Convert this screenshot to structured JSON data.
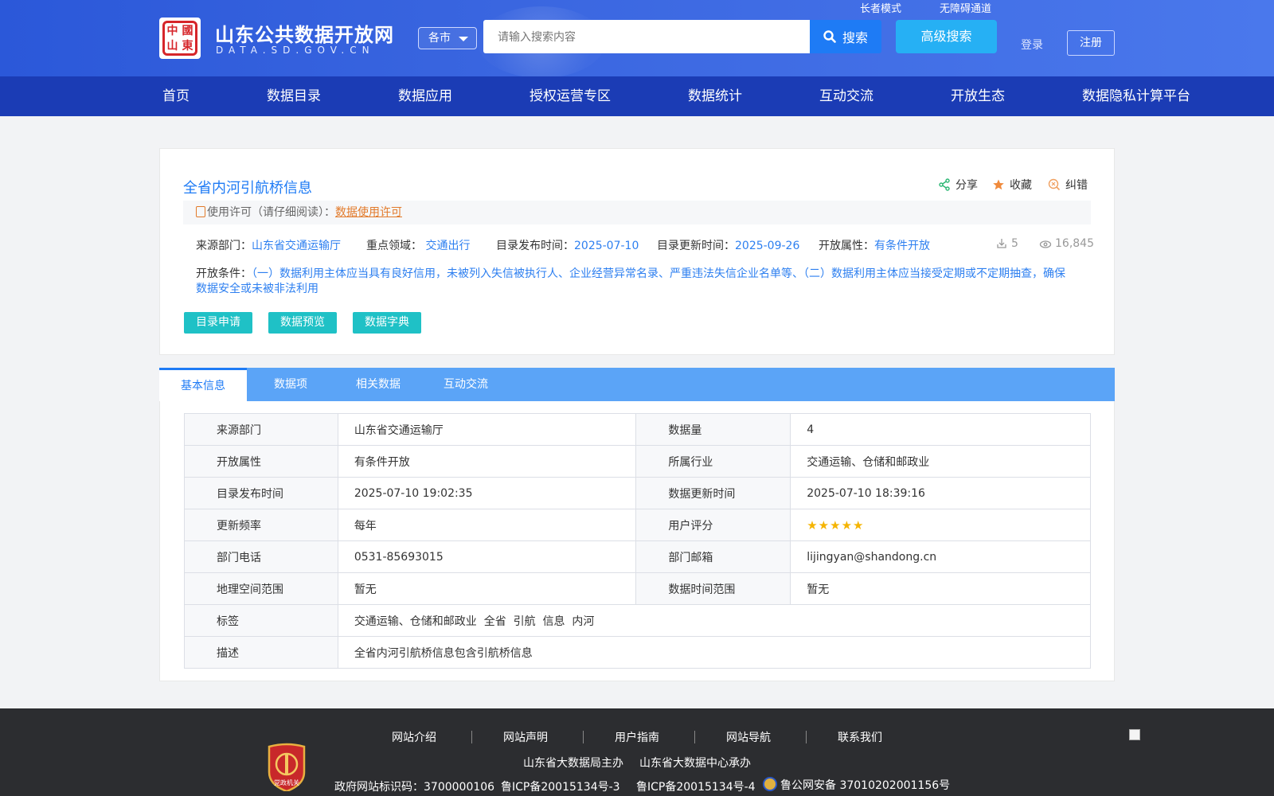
{
  "header": {
    "site_title": "山东公共数据开放网",
    "site_subtitle": "DATA.SD.GOV.CN",
    "logo_text": [
      "中",
      "國",
      "山",
      "東"
    ],
    "city_select": "各市",
    "search_placeholder": "请输入搜索内容",
    "search_button": "搜索",
    "advanced_search": "高级搜索",
    "elder_mode": "长者模式",
    "accessibility": "无障碍通道",
    "login": "登录",
    "register": "注册"
  },
  "nav": [
    "首页",
    "数据目录",
    "数据应用",
    "授权运营专区",
    "数据统计",
    "互动交流",
    "开放生态",
    "数据隐私计算平台"
  ],
  "dataset": {
    "title": "全省内河引航桥信息",
    "actions": {
      "share": "分享",
      "favorite": "收藏",
      "report": "纠错"
    },
    "license_label": "使用许可（请仔细阅读）：",
    "license_link": "数据使用许可",
    "source_label": "来源部门：",
    "source_value": "山东省交通运输厅",
    "domain_label": "重点领域：",
    "domain_value": "交通出行",
    "publish_label": "目录发布时间：",
    "publish_value": "2025-07-10",
    "update_label": "目录更新时间：",
    "update_value": "2025-09-26",
    "open_label": "开放属性：",
    "open_value": "有条件开放",
    "downloads": "5",
    "views": "16,845",
    "conditions_label": "开放条件：",
    "conditions_value": "（一）数据利用主体应当具有良好信用，未被列入失信被执行人、企业经营异常名录、严重违法失信企业名单等、（二）数据利用主体应当接受定期或不定期抽查，确保数据安全或未被非法利用",
    "buttons": [
      "目录申请",
      "数据预览",
      "数据字典"
    ]
  },
  "tabs": [
    "基本信息",
    "数据项",
    "相关数据",
    "互动交流"
  ],
  "info_table": {
    "rows": [
      {
        "k1": "来源部门",
        "v1": "山东省交通运输厅",
        "k2": "数据量",
        "v2": "4"
      },
      {
        "k1": "开放属性",
        "v1": "有条件开放",
        "k2": "所属行业",
        "v2": "交通运输、仓储和邮政业"
      },
      {
        "k1": "目录发布时间",
        "v1": "2025-07-10 19:02:35",
        "k2": "数据更新时间",
        "v2": "2025-07-10 18:39:16"
      },
      {
        "k1": "更新频率",
        "v1": "每年",
        "k2": "用户评分",
        "v2": ""
      },
      {
        "k1": "部门电话",
        "v1": "0531-85693015",
        "k2": "部门邮箱",
        "v2": "lijingyan@shandong.cn"
      },
      {
        "k1": "地理空间范围",
        "v1": "暂无",
        "k2": "数据时间范围",
        "v2": "暂无"
      }
    ],
    "rating": 5,
    "tags_label": "标签",
    "tags": "交通运输、仓储和邮政业  全省  引航  信息  内河",
    "desc_label": "描述",
    "desc": "全省内河引航桥信息包含引航桥信息"
  },
  "footer": {
    "links": [
      "网站介绍",
      "网站声明",
      "用户指南",
      "网站导航",
      "联系我们"
    ],
    "host": "山东省大数据局主办",
    "organizer": "山东省大数据中心承办",
    "gov_id": "政府网站标识码：3700000106",
    "icp1": "鲁ICP备20015134号-3",
    "icp2": "鲁ICP备20015134号-4",
    "police": "鲁公网安备 37010202001156号",
    "badge_text": "党政机关"
  },
  "colors": {
    "brand": "#2b58d9",
    "nav": "#1b3cb5",
    "accent": "#1e7bf5",
    "teal": "#1fc1c6",
    "tab_bar": "#5ba4f7"
  }
}
